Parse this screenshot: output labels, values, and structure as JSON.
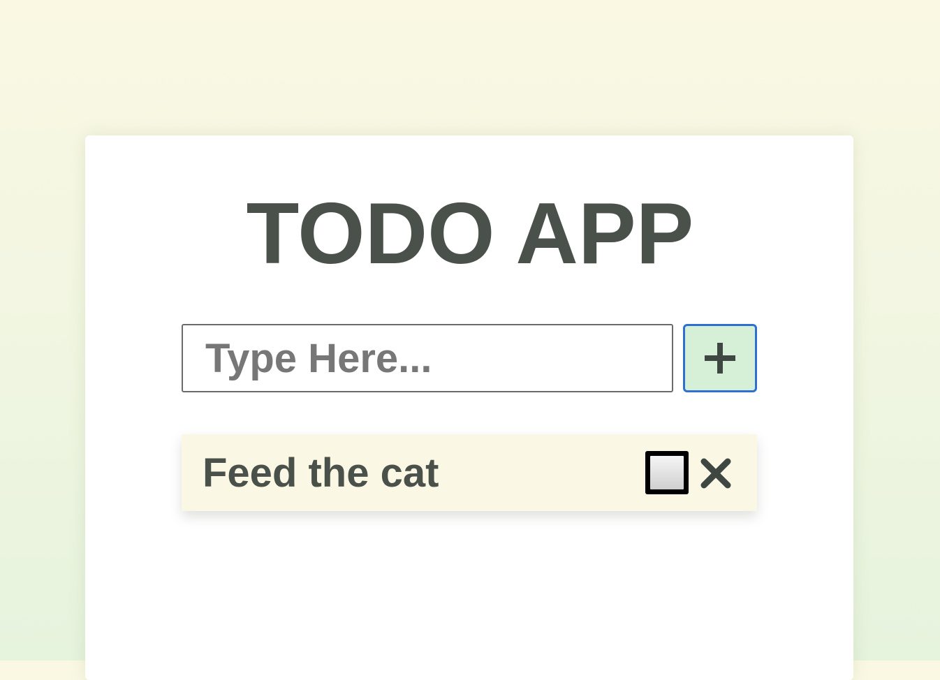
{
  "app": {
    "title": "TODO APP"
  },
  "input": {
    "placeholder": "Type Here...",
    "value": ""
  },
  "add_button": {
    "icon": "plus-icon"
  },
  "todos": [
    {
      "text": "Feed the cat",
      "completed": false,
      "check_icon": "checkbox-icon",
      "delete_icon": "close-icon"
    }
  ],
  "colors": {
    "text": "#4a514b",
    "add_button_bg": "#d6f0d8",
    "add_button_border": "#2f6fd0",
    "todo_item_bg": "#faf8e5",
    "page_bg_top": "#faf8e3",
    "page_bg_bottom": "#e6f3dd"
  }
}
